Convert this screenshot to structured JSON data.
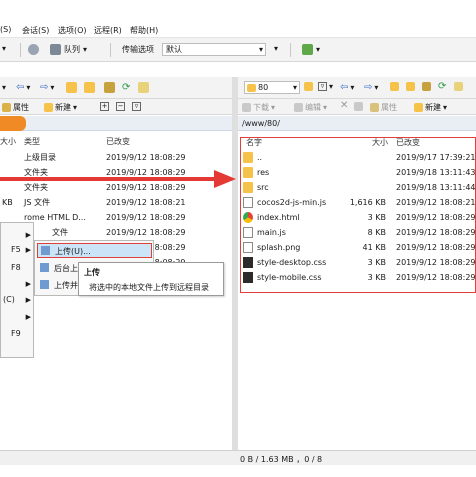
{
  "menubar": {
    "items": [
      "(S)",
      "会话(S)",
      "选项(O)",
      "远程(R)",
      "帮助(H)"
    ]
  },
  "toolbar": {
    "queue_label": "队列",
    "transfer_option_label": "传输选项",
    "transfer_option_value": "默认"
  },
  "remote_toolbar": {
    "folder_combo": "80",
    "download": "下载",
    "edit": "编辑",
    "properties": "属性",
    "new": "新建"
  },
  "local_toolbar": {
    "properties": "属性",
    "new": "新建"
  },
  "remote_path": "/www/80/",
  "local_columns": {
    "size": "大小",
    "type": "类型",
    "modified": "已改变"
  },
  "local_rows": [
    {
      "size": "",
      "type": "上级目录",
      "modified": "2019/9/12  18:08:29"
    },
    {
      "size": "",
      "type": "文件夹",
      "modified": "2019/9/12  18:08:29"
    },
    {
      "size": "",
      "type": "文件夹",
      "modified": "2019/9/12  18:08:29"
    },
    {
      "size": "KB",
      "type": "JS 文件",
      "modified": "2019/9/12  18:08:21"
    },
    {
      "size": "",
      "type": "rome HTML D...",
      "modified": "2019/9/12  18:08:29"
    },
    {
      "size": "",
      "type": "文件",
      "modified": "2019/9/12  18:08:29"
    },
    {
      "size": "",
      "type": "",
      "modified": "2019/9/12  18:08:29"
    },
    {
      "size": "",
      "type": "",
      "modified": "2019/9/12  18:08:29"
    }
  ],
  "remote_columns": {
    "name": "名字",
    "size": "大小",
    "modified": "已改变"
  },
  "remote_rows": [
    {
      "icon": "parent-folder-icon",
      "name": "..",
      "size": "",
      "modified": "2019/9/17  17:39:21"
    },
    {
      "icon": "folder-icon",
      "name": "res",
      "size": "",
      "modified": "2019/9/18  13:11:43"
    },
    {
      "icon": "folder-icon",
      "name": "src",
      "size": "",
      "modified": "2019/9/18  13:11:44"
    },
    {
      "icon": "js-file-icon",
      "name": "cocos2d-js-min.js",
      "size": "1,616 KB",
      "modified": "2019/9/12  18:08:21"
    },
    {
      "icon": "chrome-html-icon",
      "name": "index.html",
      "size": "3 KB",
      "modified": "2019/9/12  18:08:29"
    },
    {
      "icon": "js-file-icon",
      "name": "main.js",
      "size": "8 KB",
      "modified": "2019/9/12  18:08:29"
    },
    {
      "icon": "png-file-icon",
      "name": "splash.png",
      "size": "41 KB",
      "modified": "2019/9/12  18:08:29"
    },
    {
      "icon": "css-file-icon",
      "name": "style-desktop.css",
      "size": "3 KB",
      "modified": "2019/9/12  18:08:29"
    },
    {
      "icon": "css-file-icon",
      "name": "style-mobile.css",
      "size": "3 KB",
      "modified": "2019/9/12  18:08:29"
    }
  ],
  "context_menu": {
    "items": [
      "F5",
      "F8",
      "",
      "(C)",
      "",
      "F9"
    ]
  },
  "submenu": {
    "items": [
      "上传(U)...",
      "后台上",
      "上传并"
    ]
  },
  "tooltip": {
    "title": "上传",
    "description": "将选中的本地文件上传到远程目录"
  },
  "status": {
    "text": "0 B / 1.63 MB ，0 / 8"
  },
  "colors": {
    "highlight": "#e0403a",
    "arrow": "#e53935",
    "orange_tab": "#f08a24"
  }
}
